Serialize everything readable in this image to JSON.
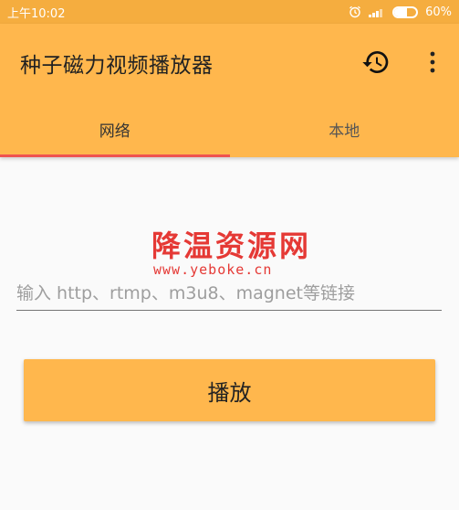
{
  "status_bar": {
    "time": "上午10:02",
    "battery_text": "60%",
    "battery_level": 0.6,
    "icons": [
      "alarm-icon",
      "signal-icon",
      "battery-icon"
    ]
  },
  "app_bar": {
    "title": "种子磁力视频播放器",
    "icons": [
      "history-icon",
      "more-vert-icon"
    ]
  },
  "tabs": [
    {
      "label": "网络",
      "active": true
    },
    {
      "label": "本地",
      "active": false
    }
  ],
  "watermark": {
    "title": "降温资源网",
    "url": "www.yeboke.cn"
  },
  "url_input": {
    "value": "",
    "placeholder": "输入 http、rtmp、m3u8、magnet等链接"
  },
  "play_button": {
    "label": "播放"
  },
  "colors": {
    "status_bar": "#f5ad3f",
    "primary": "#ffb74d",
    "tab_indicator": "#ef5350",
    "watermark": "#e53935"
  }
}
